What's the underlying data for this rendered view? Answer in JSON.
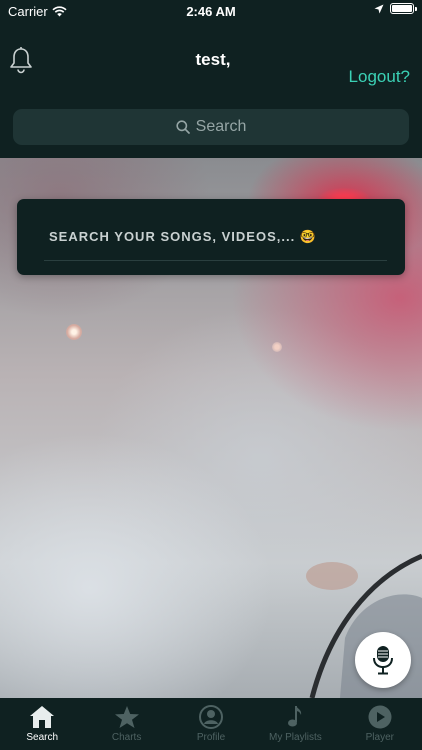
{
  "status_bar": {
    "carrier": "Carrier",
    "time": "2:46 AM"
  },
  "header": {
    "username": "test,",
    "logout_label": "Logout?"
  },
  "search": {
    "placeholder": "Search"
  },
  "card": {
    "prompt": "SEARCH YOUR SONGS, VIDEOS,... 🤓"
  },
  "tabs": [
    {
      "label": "Search",
      "icon": "home-icon",
      "active": true
    },
    {
      "label": "Charts",
      "icon": "star-icon",
      "active": false
    },
    {
      "label": "Profile",
      "icon": "person-icon",
      "active": false
    },
    {
      "label": "My Playlists",
      "icon": "music-note-icon",
      "active": false
    },
    {
      "label": "Player",
      "icon": "play-icon",
      "active": false
    }
  ],
  "colors": {
    "background": "#0f2121",
    "accent": "#3bd1b5",
    "search_field": "#1f3535",
    "inactive_tab": "#4e6262"
  }
}
